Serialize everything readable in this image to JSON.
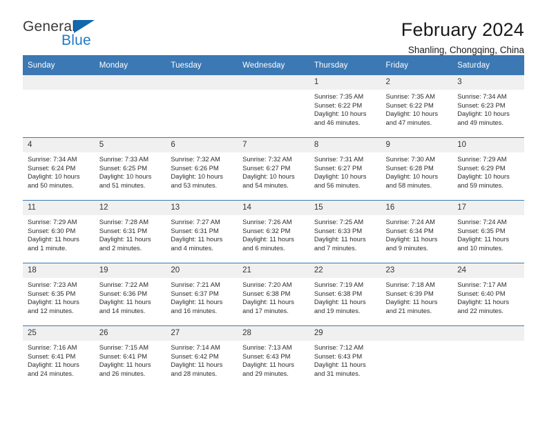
{
  "brand": {
    "name_top": "General",
    "name_bottom": "Blue",
    "accent_color": "#1268ad",
    "text_color": "#3a3a3a"
  },
  "header": {
    "title": "February 2024",
    "location": "Shanling, Chongqing, China",
    "header_bg_color": "#3b78b4",
    "grid_line_color": "#3b78b4",
    "daynum_bg_color": "#f0f0f0"
  },
  "weekday_headers": [
    "Sunday",
    "Monday",
    "Tuesday",
    "Wednesday",
    "Thursday",
    "Friday",
    "Saturday"
  ],
  "labels": {
    "sunrise_prefix": "Sunrise:",
    "sunset_prefix": "Sunset:",
    "daylight_prefix": "Daylight:"
  },
  "weeks": [
    [
      {
        "empty": true
      },
      {
        "empty": true
      },
      {
        "empty": true
      },
      {
        "empty": true
      },
      {
        "day": "1",
        "sunrise": "Sunrise: 7:35 AM",
        "sunset": "Sunset: 6:22 PM",
        "daylight": "Daylight: 10 hours and 46 minutes."
      },
      {
        "day": "2",
        "sunrise": "Sunrise: 7:35 AM",
        "sunset": "Sunset: 6:22 PM",
        "daylight": "Daylight: 10 hours and 47 minutes."
      },
      {
        "day": "3",
        "sunrise": "Sunrise: 7:34 AM",
        "sunset": "Sunset: 6:23 PM",
        "daylight": "Daylight: 10 hours and 49 minutes."
      }
    ],
    [
      {
        "day": "4",
        "sunrise": "Sunrise: 7:34 AM",
        "sunset": "Sunset: 6:24 PM",
        "daylight": "Daylight: 10 hours and 50 minutes."
      },
      {
        "day": "5",
        "sunrise": "Sunrise: 7:33 AM",
        "sunset": "Sunset: 6:25 PM",
        "daylight": "Daylight: 10 hours and 51 minutes."
      },
      {
        "day": "6",
        "sunrise": "Sunrise: 7:32 AM",
        "sunset": "Sunset: 6:26 PM",
        "daylight": "Daylight: 10 hours and 53 minutes."
      },
      {
        "day": "7",
        "sunrise": "Sunrise: 7:32 AM",
        "sunset": "Sunset: 6:27 PM",
        "daylight": "Daylight: 10 hours and 54 minutes."
      },
      {
        "day": "8",
        "sunrise": "Sunrise: 7:31 AM",
        "sunset": "Sunset: 6:27 PM",
        "daylight": "Daylight: 10 hours and 56 minutes."
      },
      {
        "day": "9",
        "sunrise": "Sunrise: 7:30 AM",
        "sunset": "Sunset: 6:28 PM",
        "daylight": "Daylight: 10 hours and 58 minutes."
      },
      {
        "day": "10",
        "sunrise": "Sunrise: 7:29 AM",
        "sunset": "Sunset: 6:29 PM",
        "daylight": "Daylight: 10 hours and 59 minutes."
      }
    ],
    [
      {
        "day": "11",
        "sunrise": "Sunrise: 7:29 AM",
        "sunset": "Sunset: 6:30 PM",
        "daylight": "Daylight: 11 hours and 1 minute."
      },
      {
        "day": "12",
        "sunrise": "Sunrise: 7:28 AM",
        "sunset": "Sunset: 6:31 PM",
        "daylight": "Daylight: 11 hours and 2 minutes."
      },
      {
        "day": "13",
        "sunrise": "Sunrise: 7:27 AM",
        "sunset": "Sunset: 6:31 PM",
        "daylight": "Daylight: 11 hours and 4 minutes."
      },
      {
        "day": "14",
        "sunrise": "Sunrise: 7:26 AM",
        "sunset": "Sunset: 6:32 PM",
        "daylight": "Daylight: 11 hours and 6 minutes."
      },
      {
        "day": "15",
        "sunrise": "Sunrise: 7:25 AM",
        "sunset": "Sunset: 6:33 PM",
        "daylight": "Daylight: 11 hours and 7 minutes."
      },
      {
        "day": "16",
        "sunrise": "Sunrise: 7:24 AM",
        "sunset": "Sunset: 6:34 PM",
        "daylight": "Daylight: 11 hours and 9 minutes."
      },
      {
        "day": "17",
        "sunrise": "Sunrise: 7:24 AM",
        "sunset": "Sunset: 6:35 PM",
        "daylight": "Daylight: 11 hours and 10 minutes."
      }
    ],
    [
      {
        "day": "18",
        "sunrise": "Sunrise: 7:23 AM",
        "sunset": "Sunset: 6:35 PM",
        "daylight": "Daylight: 11 hours and 12 minutes."
      },
      {
        "day": "19",
        "sunrise": "Sunrise: 7:22 AM",
        "sunset": "Sunset: 6:36 PM",
        "daylight": "Daylight: 11 hours and 14 minutes."
      },
      {
        "day": "20",
        "sunrise": "Sunrise: 7:21 AM",
        "sunset": "Sunset: 6:37 PM",
        "daylight": "Daylight: 11 hours and 16 minutes."
      },
      {
        "day": "21",
        "sunrise": "Sunrise: 7:20 AM",
        "sunset": "Sunset: 6:38 PM",
        "daylight": "Daylight: 11 hours and 17 minutes."
      },
      {
        "day": "22",
        "sunrise": "Sunrise: 7:19 AM",
        "sunset": "Sunset: 6:38 PM",
        "daylight": "Daylight: 11 hours and 19 minutes."
      },
      {
        "day": "23",
        "sunrise": "Sunrise: 7:18 AM",
        "sunset": "Sunset: 6:39 PM",
        "daylight": "Daylight: 11 hours and 21 minutes."
      },
      {
        "day": "24",
        "sunrise": "Sunrise: 7:17 AM",
        "sunset": "Sunset: 6:40 PM",
        "daylight": "Daylight: 11 hours and 22 minutes."
      }
    ],
    [
      {
        "day": "25",
        "sunrise": "Sunrise: 7:16 AM",
        "sunset": "Sunset: 6:41 PM",
        "daylight": "Daylight: 11 hours and 24 minutes."
      },
      {
        "day": "26",
        "sunrise": "Sunrise: 7:15 AM",
        "sunset": "Sunset: 6:41 PM",
        "daylight": "Daylight: 11 hours and 26 minutes."
      },
      {
        "day": "27",
        "sunrise": "Sunrise: 7:14 AM",
        "sunset": "Sunset: 6:42 PM",
        "daylight": "Daylight: 11 hours and 28 minutes."
      },
      {
        "day": "28",
        "sunrise": "Sunrise: 7:13 AM",
        "sunset": "Sunset: 6:43 PM",
        "daylight": "Daylight: 11 hours and 29 minutes."
      },
      {
        "day": "29",
        "sunrise": "Sunrise: 7:12 AM",
        "sunset": "Sunset: 6:43 PM",
        "daylight": "Daylight: 11 hours and 31 minutes."
      },
      {
        "empty": true
      },
      {
        "empty": true
      }
    ]
  ]
}
